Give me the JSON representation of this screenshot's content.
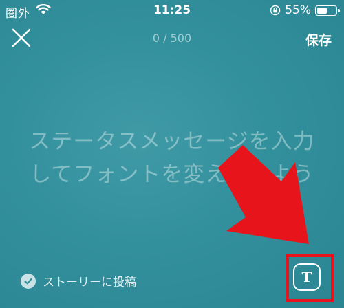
{
  "status_bar": {
    "carrier": "圏外",
    "time": "11:25",
    "battery_percent": "55%",
    "battery_level": 0.55,
    "icons": [
      "wifi-icon",
      "orientation-lock-icon",
      "battery-icon"
    ]
  },
  "header": {
    "close_icon": "close-icon",
    "counter": "0 / 500",
    "save_label": "保存"
  },
  "editor": {
    "placeholder_line1": "ステータスメッセージを入力",
    "placeholder_line2": "してフォントを変えてみよう"
  },
  "footer": {
    "story_label": "ストーリーに投稿",
    "story_checked": true,
    "font_button_glyph": "T",
    "font_button_icon": "text-font-icon"
  },
  "annotation": {
    "color": "#e8141b",
    "type": "red-arrow-and-highlight-box"
  },
  "colors": {
    "background": "#3396a2",
    "text": "#ffffff"
  }
}
